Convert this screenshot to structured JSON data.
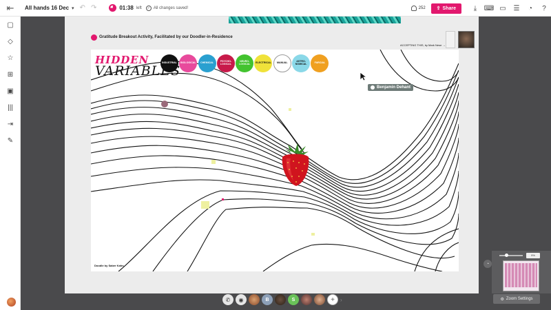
{
  "topbar": {
    "board_title": "All hands 16 Dec",
    "timer": "01:38",
    "timer_suffix": "left",
    "save_status": "All changes saved!",
    "user_count": "252",
    "share_label": "Share"
  },
  "frame": {
    "header_title": "Gratitude Breakout Activity, Facilitated by our Doodler-in-Residence",
    "accepting_text": "ACCEPTING THIS, by Mark Nese →",
    "art_title_top": "HIDDEN",
    "art_title_bottom": "VARIABLES",
    "credit": "Doodle by Saber Kahn",
    "categories": [
      {
        "label": "INDUSTRIAL",
        "color": "#111111"
      },
      {
        "label": "BIOLOGICAL",
        "color": "#e84a9c"
      },
      {
        "label": "CHEMICAL",
        "color": "#2aa0d0"
      },
      {
        "label": "PSYCHO-LOGICAL",
        "color": "#c81a4a"
      },
      {
        "label": "NEURO-LOGICAL",
        "color": "#43c32f"
      },
      {
        "label": "ELECTRICAL",
        "color": "#f0e23a"
      },
      {
        "label": "MANUAL",
        "color": "#ffffff"
      },
      {
        "label": "ASTRO-NOMICAL",
        "color": "#8ad8e8"
      },
      {
        "label": "FARCIAL",
        "color": "#f0a020"
      }
    ]
  },
  "cursor_user": "Benjamin Dehant",
  "zoom": {
    "percent": "9%",
    "settings_label": "Zoom Settings"
  },
  "presence": {
    "initial_b": "B",
    "initial_s": "S"
  },
  "colors": {
    "brand": "#e2186e",
    "canvas_bg": "#4a4a4c"
  }
}
